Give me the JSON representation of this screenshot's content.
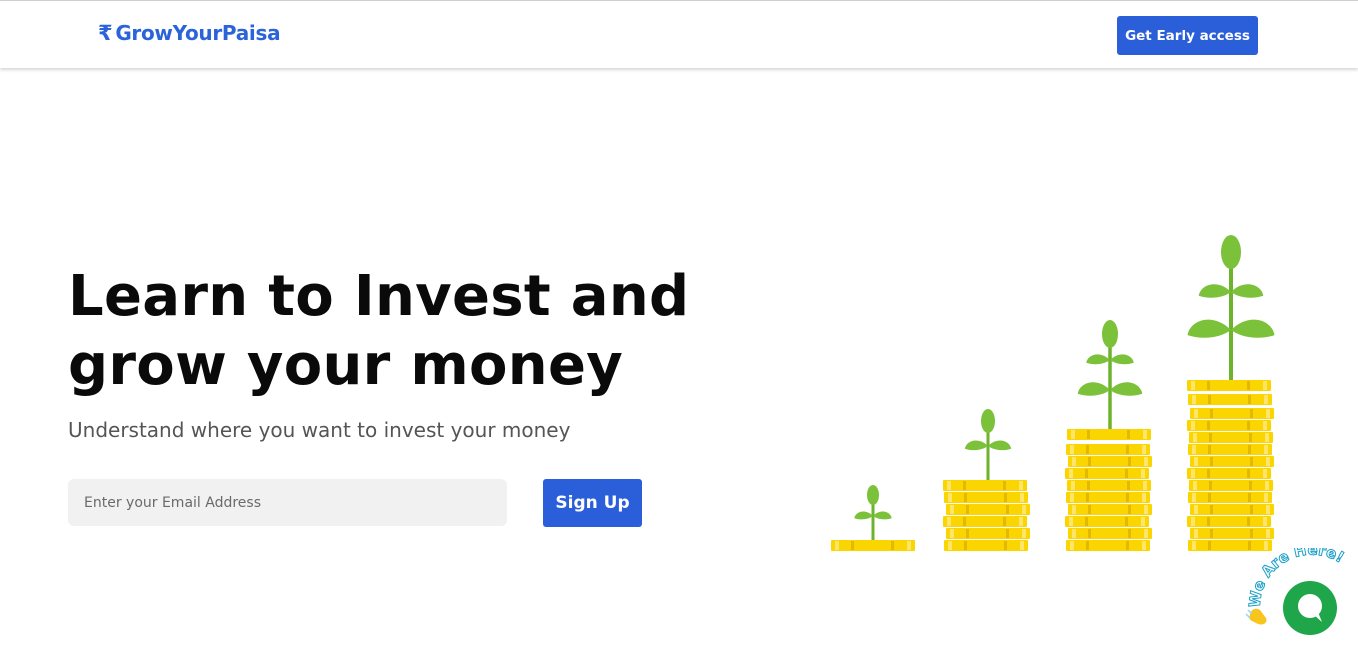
{
  "header": {
    "brand_symbol": "₹",
    "brand_name": "GrowYourPaisa",
    "cta_label": "Get Early access"
  },
  "hero": {
    "title_line1": "Learn to Invest and",
    "title_line2": "grow your money",
    "subtitle": "Understand where you want to invest your money",
    "email_placeholder": "Enter your Email Address",
    "signup_label": "Sign Up"
  },
  "illustration": {
    "name": "growing-coin-stacks-illustration",
    "coin_color": "#f5d100",
    "plant_color": "#7cc13a"
  },
  "chat": {
    "badge_text": "We Are Here!",
    "icon": "chat-bubble-icon",
    "color": "#1fa64a"
  },
  "colors": {
    "primary": "#2b5fd9",
    "brand_text": "#2b63d9"
  }
}
